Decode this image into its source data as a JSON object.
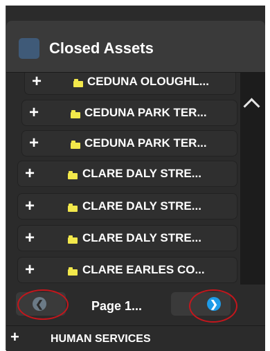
{
  "header": {
    "title": "Closed Assets",
    "swatch_color": "#3f5a78"
  },
  "items": [
    {
      "label": "CEDUNA OLOUGHL..."
    },
    {
      "label": "CEDUNA PARK TER..."
    },
    {
      "label": "CEDUNA PARK TER..."
    },
    {
      "label": "CLARE DALY STRE..."
    },
    {
      "label": "CLARE DALY STRE..."
    },
    {
      "label": "CLARE DALY STRE..."
    },
    {
      "label": "CLARE EARLES CO..."
    }
  ],
  "pager": {
    "label": "Page 1...",
    "prev_icon": "arrow-left-circle-icon",
    "next_icon": "arrow-right-circle-icon",
    "prev_color": "#6b7a86",
    "next_color": "#1e9be8"
  },
  "bottom": {
    "label": "HUMAN SERVICES"
  },
  "colors": {
    "folder": "#f2e84b",
    "highlight_ring": "#c4161c"
  }
}
